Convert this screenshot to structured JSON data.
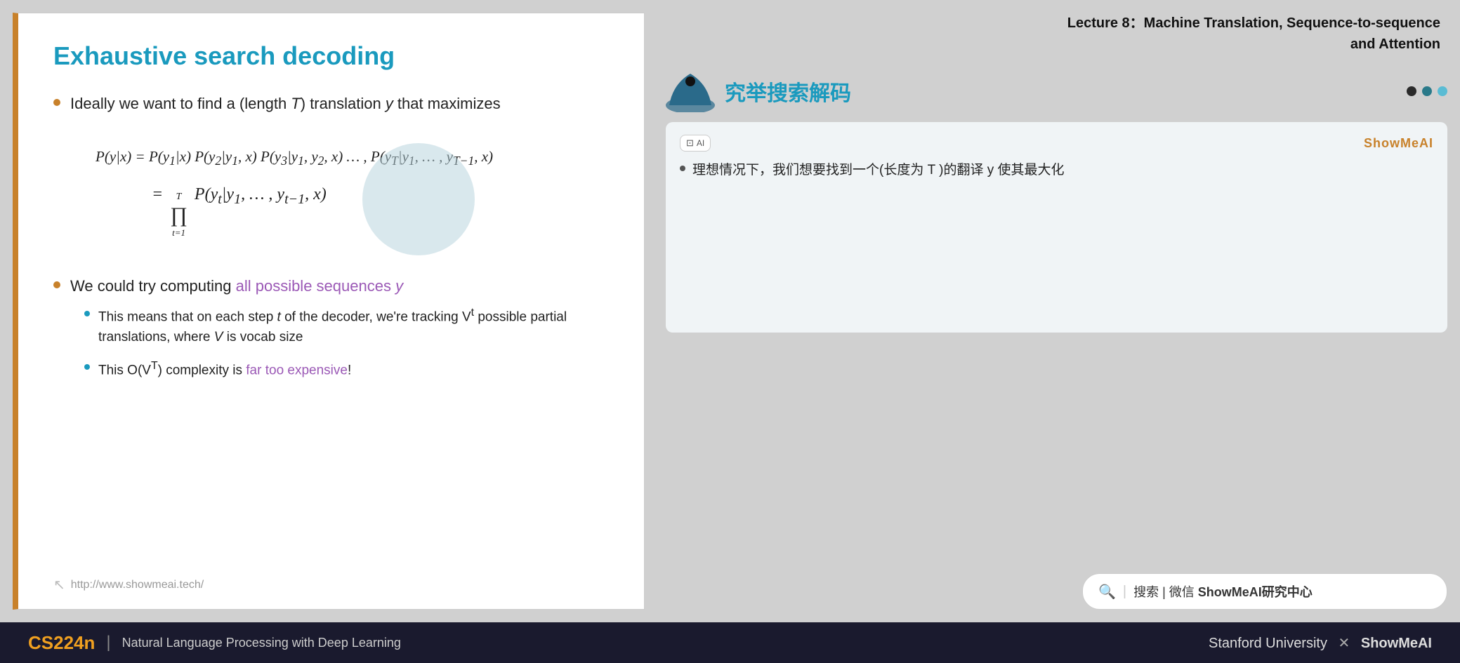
{
  "slide": {
    "title": "Exhaustive search decoding",
    "border_color": "#c8812a",
    "bullet1": {
      "text": "Ideally we want to find a (length ",
      "italic_t": "T",
      "text2": ") translation ",
      "italic_y": "y",
      "text3": " that maximizes"
    },
    "math_formula": "P(y|x) = P(y₁|x) P(y₂|y₁, x) P(y₃|y₁, y₂, x) …, P(yT|y₁, …, yT-1, x)",
    "math_formula2": "= ∏ P(yt|y₁, …, yt-1, x)",
    "math_product_label": "T",
    "math_product_sub": "t=1",
    "bullet2_prefix": "We could try computing ",
    "bullet2_highlight": "all possible sequences y",
    "sub_bullet1": "This means that on each step ",
    "sub_bullet1_t": "t",
    "sub_bullet1_cont": " of the decoder, we're tracking V",
    "sub_bullet1_sup": "t",
    "sub_bullet1_end": " possible partial translations, where ",
    "sub_bullet1_v": "V",
    "sub_bullet1_final": " is vocab size",
    "sub_bullet2_prefix": "This O(V",
    "sub_bullet2_sup": "T",
    "sub_bullet2_mid": ") complexity is ",
    "sub_bullet2_highlight": "far too expensive",
    "sub_bullet2_end": "!",
    "footer_url": "http://www.showmeai.tech/"
  },
  "right_panel": {
    "lecture_line1": "Lecture 8：Machine Translation, Sequence-to-sequence",
    "lecture_line2": "and Attention",
    "chinese_title": "究举搜索解码",
    "showmeai_label": "ShowMeAI",
    "translation_bullet": "理想情况下，我们想要找到一个(长度为 T )的翻译 y 使其最大化",
    "search_text": "搜索 | 微信 ",
    "search_bold": "ShowMeAI研究中心"
  },
  "footer": {
    "course_code": "CS224n",
    "divider": "|",
    "course_name": "Natural Language Processing with Deep Learning",
    "university": "Stanford University",
    "x_symbol": "✕",
    "brand": "ShowMeAI"
  }
}
